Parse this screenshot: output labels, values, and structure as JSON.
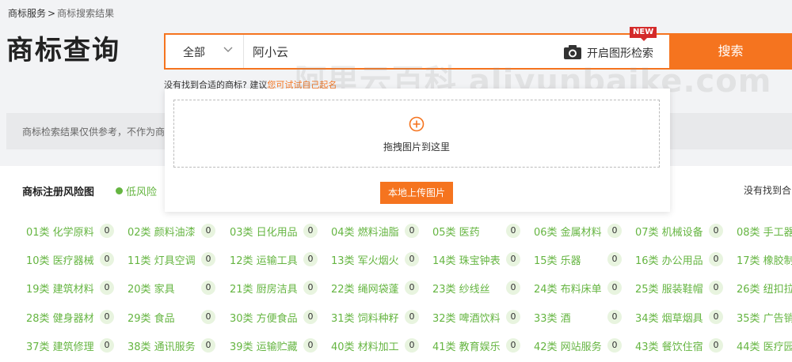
{
  "breadcrumb": {
    "root": "商标服务",
    "separator": ">",
    "current": "商标搜索结果"
  },
  "page_title": "商标查询",
  "search": {
    "scope_label": "全部",
    "query_value": "阿小云",
    "image_search_label": "开启图形检索",
    "new_badge": "NEW",
    "button_label": "搜索"
  },
  "hint": {
    "prefix": "没有找到合适的商标? 建议",
    "link": "您可试试自己起名"
  },
  "watermark": "阿里云百科 aliyunbaike.com",
  "notice": "商标检索结果仅供参考，不作为商标",
  "upload_panel": {
    "drop_text": "拖拽图片到这里",
    "upload_button": "本地上传图片"
  },
  "risk": {
    "title": "商标注册风险图",
    "level": "低风险",
    "right_note": "没有找到合"
  },
  "colors": {
    "accent": "#f5741f",
    "green": "#65b541",
    "new_badge": "#d42a2a"
  },
  "classes": [
    {
      "name": "01类 化学原料",
      "count": "0"
    },
    {
      "name": "02类 颜料油漆",
      "count": "0"
    },
    {
      "name": "03类 日化用品",
      "count": "0"
    },
    {
      "name": "04类 燃料油脂",
      "count": "0"
    },
    {
      "name": "05类 医药",
      "count": "0"
    },
    {
      "name": "06类 金属材料",
      "count": "0"
    },
    {
      "name": "07类 机械设备",
      "count": "0"
    },
    {
      "name": "08类 手工器",
      "count": ""
    },
    {
      "name": "10类 医疗器械",
      "count": "0"
    },
    {
      "name": "11类 灯具空调",
      "count": "0"
    },
    {
      "name": "12类 运输工具",
      "count": "0"
    },
    {
      "name": "13类 军火烟火",
      "count": "0"
    },
    {
      "name": "14类 珠宝钟表",
      "count": "0"
    },
    {
      "name": "15类 乐器",
      "count": "0"
    },
    {
      "name": "16类 办公用品",
      "count": "0"
    },
    {
      "name": "17类 橡胶制",
      "count": ""
    },
    {
      "name": "19类 建筑材料",
      "count": "0"
    },
    {
      "name": "20类 家具",
      "count": "0"
    },
    {
      "name": "21类 厨房洁具",
      "count": "0"
    },
    {
      "name": "22类 绳网袋蓬",
      "count": "0"
    },
    {
      "name": "23类 纱线丝",
      "count": "0"
    },
    {
      "name": "24类 布料床单",
      "count": "0"
    },
    {
      "name": "25类 服装鞋帽",
      "count": "0"
    },
    {
      "name": "26类 纽扣拉",
      "count": ""
    },
    {
      "name": "28类 健身器材",
      "count": "0"
    },
    {
      "name": "29类 食品",
      "count": "0"
    },
    {
      "name": "30类 方便食品",
      "count": "0"
    },
    {
      "name": "31类 饲料种籽",
      "count": "0"
    },
    {
      "name": "32类 啤酒饮料",
      "count": "0"
    },
    {
      "name": "33类 酒",
      "count": "0"
    },
    {
      "name": "34类 烟草烟具",
      "count": "0"
    },
    {
      "name": "35类 广告销",
      "count": ""
    },
    {
      "name": "37类 建筑修理",
      "count": "0"
    },
    {
      "name": "38类 通讯服务",
      "count": "0"
    },
    {
      "name": "39类 运输贮藏",
      "count": "0"
    },
    {
      "name": "40类 材料加工",
      "count": "0"
    },
    {
      "name": "41类 教育娱乐",
      "count": "0"
    },
    {
      "name": "42类 网站服务",
      "count": "0"
    },
    {
      "name": "43类 餐饮住宿",
      "count": "0"
    },
    {
      "name": "44类 医疗园",
      "count": ""
    }
  ]
}
